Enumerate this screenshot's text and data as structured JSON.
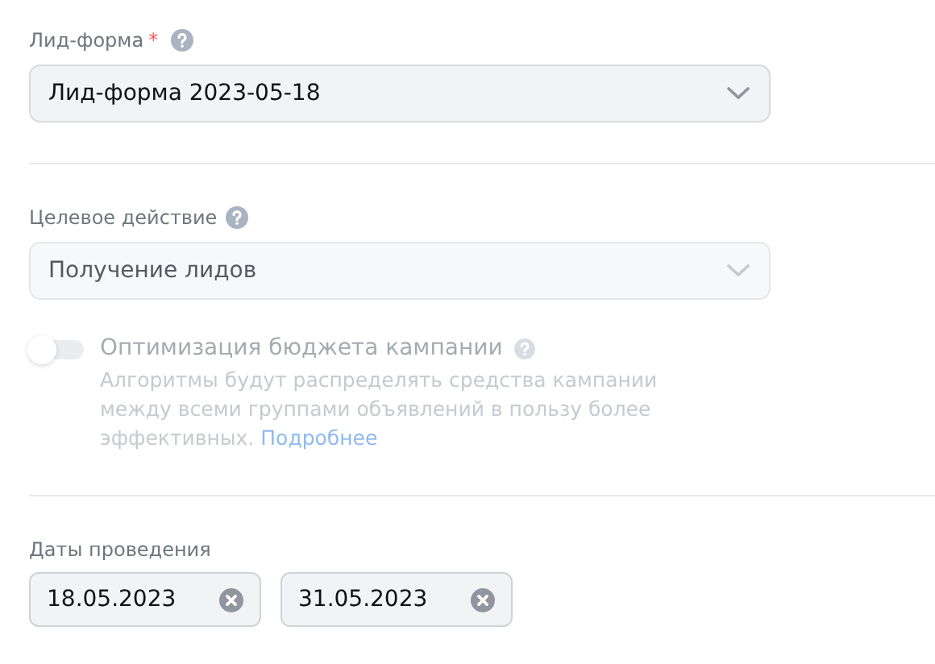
{
  "lead_form": {
    "label": "Лид-форма",
    "required": true,
    "required_mark": "*",
    "value": "Лид-форма 2023-05-18",
    "disabled": false
  },
  "target_action": {
    "label": "Целевое действие",
    "value": "Получение лидов",
    "disabled": true
  },
  "budget_optimization": {
    "label": "Оптимизация бюджета кампании",
    "on": false,
    "disabled": true,
    "description": "Алгоритмы будут распределять средства кампании между всеми группами объявлений в пользу более эффективных.",
    "link": "Подробнее"
  },
  "dates": {
    "label": "Даты проведения",
    "fields": [
      {
        "value": "18.05.2023"
      },
      {
        "value": "31.05.2023"
      }
    ]
  }
}
